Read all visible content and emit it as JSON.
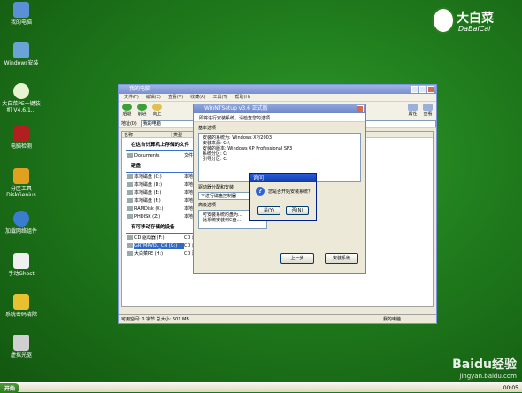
{
  "desktop_icons": [
    {
      "label": "我的电脑",
      "icon": "computer-icon"
    },
    {
      "label": "Windows安装",
      "icon": "installer-icon"
    },
    {
      "label": "大白菜PE一键装机 V4.6.1...",
      "icon": "cabbage-icon"
    },
    {
      "label": "电脑检测",
      "icon": "detect-icon"
    },
    {
      "label": "分区工具 DiskGenius",
      "icon": "partition-icon"
    },
    {
      "label": "加载网络组件",
      "icon": "network-icon"
    },
    {
      "label": "手动Ghost",
      "icon": "ghost-icon"
    },
    {
      "label": "系统密码清除",
      "icon": "key-icon"
    },
    {
      "label": "虚拟光驱",
      "icon": "cdrom-icon"
    }
  ],
  "logo": {
    "cn": "大白菜",
    "en": "DaBaiCai"
  },
  "explorer": {
    "title": "我的电脑",
    "menus": [
      "文件(F)",
      "编辑(E)",
      "查看(V)",
      "收藏(A)",
      "工具(T)",
      "帮助(H)"
    ],
    "toolbar": {
      "back": "后退",
      "forward": "前进",
      "up": "向上",
      "props": "属性",
      "view": "查看"
    },
    "address_label": "地址(D)",
    "address_value": "我的电脑",
    "col_headers": [
      "名称",
      "类型"
    ],
    "groups": [
      {
        "title": "在这台计算机上存储的文件",
        "rows": [
          {
            "name": "Documents",
            "type": "文件夹"
          }
        ]
      },
      {
        "title": "硬盘",
        "rows": [
          {
            "name": "本地磁盘 (C:)",
            "type": "本地磁盘"
          },
          {
            "name": "本地磁盘 (D:)",
            "type": "本地磁盘"
          },
          {
            "name": "本地磁盘 (E:)",
            "type": "本地磁盘"
          },
          {
            "name": "本地磁盘 (F:)",
            "type": "本地磁盘"
          },
          {
            "name": "RAMDisk (X:)",
            "type": "本地磁盘"
          },
          {
            "name": "PHDISK (Z:)",
            "type": "本地磁盘"
          }
        ]
      },
      {
        "title": "有可移动存储的设备",
        "rows": [
          {
            "name": "CD 驱动器 (F:)",
            "type": "CD 驱动器"
          },
          {
            "name": "GRTMPVOL_CN (G:)",
            "type": "CD 驱动器"
          },
          {
            "name": "大白菜PE (H:)",
            "type": "CD 驱动器"
          }
        ]
      }
    ],
    "status_left": "可用空间: 0 字节 总大小: 601 MB",
    "status_right": "我的电脑"
  },
  "setup": {
    "title": "WinNTSetup v3.6 正式版",
    "header": "即将进行安装系统，请检查您的选项",
    "section1": "基本选项",
    "lines": [
      "安装的系统为: Windows XP/2003",
      "安装来源: G:\\",
      "安装的版本: Windows XP Professional SP3",
      "系统分区: C:",
      "引导分区: C:"
    ],
    "section2": "驱动器分配和安装",
    "dropdown": "不进行磁盘控制器",
    "section3": "高级选项",
    "adv_lines": [
      "可安装系统的盘为...",
      "此系统安装到C盘..."
    ],
    "back_btn": "上一步",
    "install_btn": "安装系统"
  },
  "confirm": {
    "title": "询问",
    "message": "您是否开始安装系统？",
    "ok": "是(Y)",
    "no": "否(N)"
  },
  "taskbar": {
    "start": "开始",
    "clock": "00:05"
  },
  "watermark": {
    "brand": "Baidu经验",
    "url": "jingyan.baidu.com"
  }
}
